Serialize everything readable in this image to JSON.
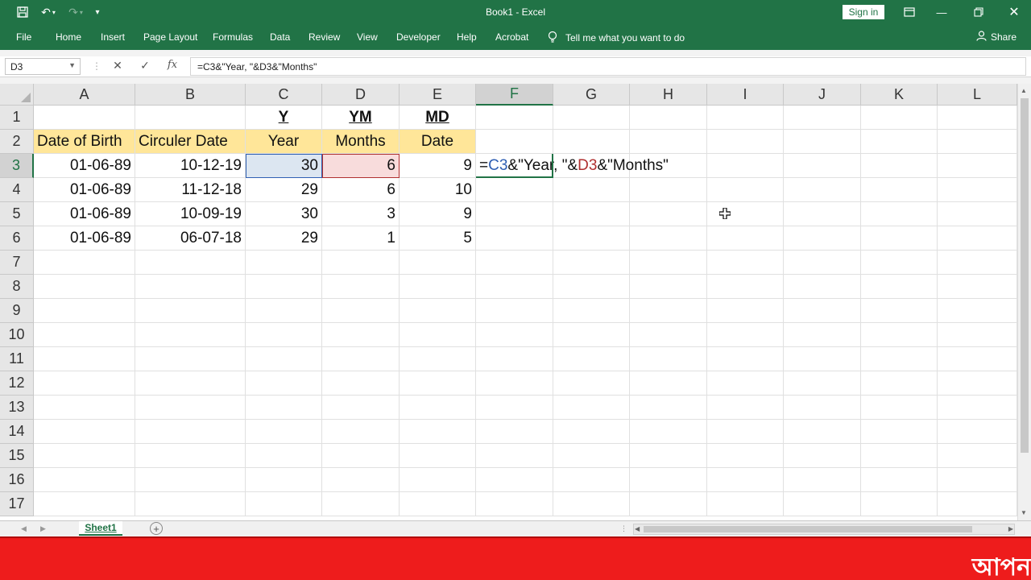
{
  "titlebar": {
    "title": "Book1  -  Excel",
    "signin_label": "Sign in"
  },
  "ribbon": {
    "tabs": [
      "File",
      "Home",
      "Insert",
      "Page Layout",
      "Formulas",
      "Data",
      "Review",
      "View",
      "Developer",
      "Help",
      "Acrobat"
    ],
    "tell_me": "Tell me what you want to do",
    "share": "Share"
  },
  "formula_bar": {
    "name_box": "D3",
    "formula": "=C3&\"Year, \"&D3&\"Months\"",
    "fx": "fx"
  },
  "columns": [
    "A",
    "B",
    "C",
    "D",
    "E",
    "F",
    "G",
    "H",
    "I",
    "J",
    "K",
    "L"
  ],
  "active_column": "F",
  "rows": [
    "1",
    "2",
    "3",
    "4",
    "5",
    "6",
    "7",
    "8",
    "9",
    "10",
    "11",
    "12",
    "13",
    "14",
    "15",
    "16",
    "17"
  ],
  "active_row": "3",
  "cells": {
    "C1": "Y",
    "D1": "YM",
    "E1": "MD",
    "A2": "Date of Birth",
    "B2": "Circuler Date",
    "C2": "Year",
    "D2": "Months",
    "E2": "Date",
    "A3": "01-06-89",
    "B3": "10-12-19",
    "C3": "30",
    "D3": "6",
    "E3": "9",
    "A4": "01-06-89",
    "B4": "11-12-18",
    "C4": "29",
    "D4": "6",
    "E4": "10",
    "A5": "01-06-89",
    "B5": "10-09-19",
    "C5": "30",
    "D5": "3",
    "E5": "9",
    "A6": "01-06-89",
    "B6": "06-07-18",
    "C6": "29",
    "D6": "1",
    "E6": "5"
  },
  "editing_cell": {
    "parts": [
      "=",
      "C3",
      "&\"Year, \"&",
      "D3",
      "&\"Months\""
    ]
  },
  "sheet_tabs": [
    "Sheet1"
  ],
  "overlay_text": "আপন",
  "colors": {
    "excel_green": "#217346",
    "header_highlight": "#ffe699",
    "ref_blue": "#2f5fb3",
    "ref_red": "#b03030",
    "banner_red": "#ee1c1c"
  }
}
